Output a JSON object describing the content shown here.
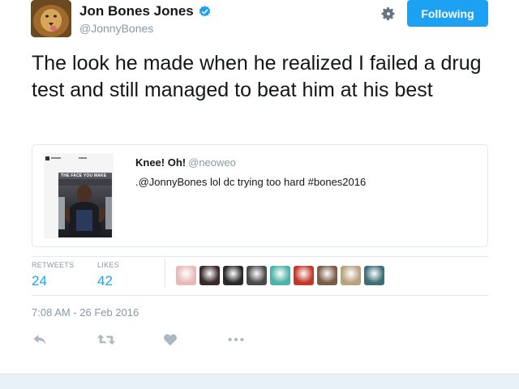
{
  "user": {
    "display_name": "Jon Bones Jones",
    "handle": "@JonnyBones",
    "follow_label": "Following"
  },
  "tweet": {
    "text": "The look he made when he realized I failed a drug test and still managed to beat him at his best",
    "timestamp": "7:08 AM - 26 Feb 2016"
  },
  "quote": {
    "name": "Knee! Oh!",
    "handle": "@neoweo",
    "text": ".@JonnyBones lol dc trying too hard #bones2016",
    "media_caption": "THE FACE YOU MAKE"
  },
  "stats": {
    "retweets_label": "RETWEETS",
    "retweets": "24",
    "likes_label": "LIKES",
    "likes": "42"
  },
  "likers": [
    {
      "color": "#e9b9b9"
    },
    {
      "color": "#3b2a2a"
    },
    {
      "color": "#2a2a2a"
    },
    {
      "color": "#4a4a4a"
    },
    {
      "color": "#4bb3a8"
    },
    {
      "color": "#c0392b"
    },
    {
      "color": "#7a5c48"
    },
    {
      "color": "#b9a27e"
    },
    {
      "color": "#3d6e78"
    }
  ],
  "colors": {
    "accent": "#1da1f2",
    "muted": "#8899a6"
  }
}
